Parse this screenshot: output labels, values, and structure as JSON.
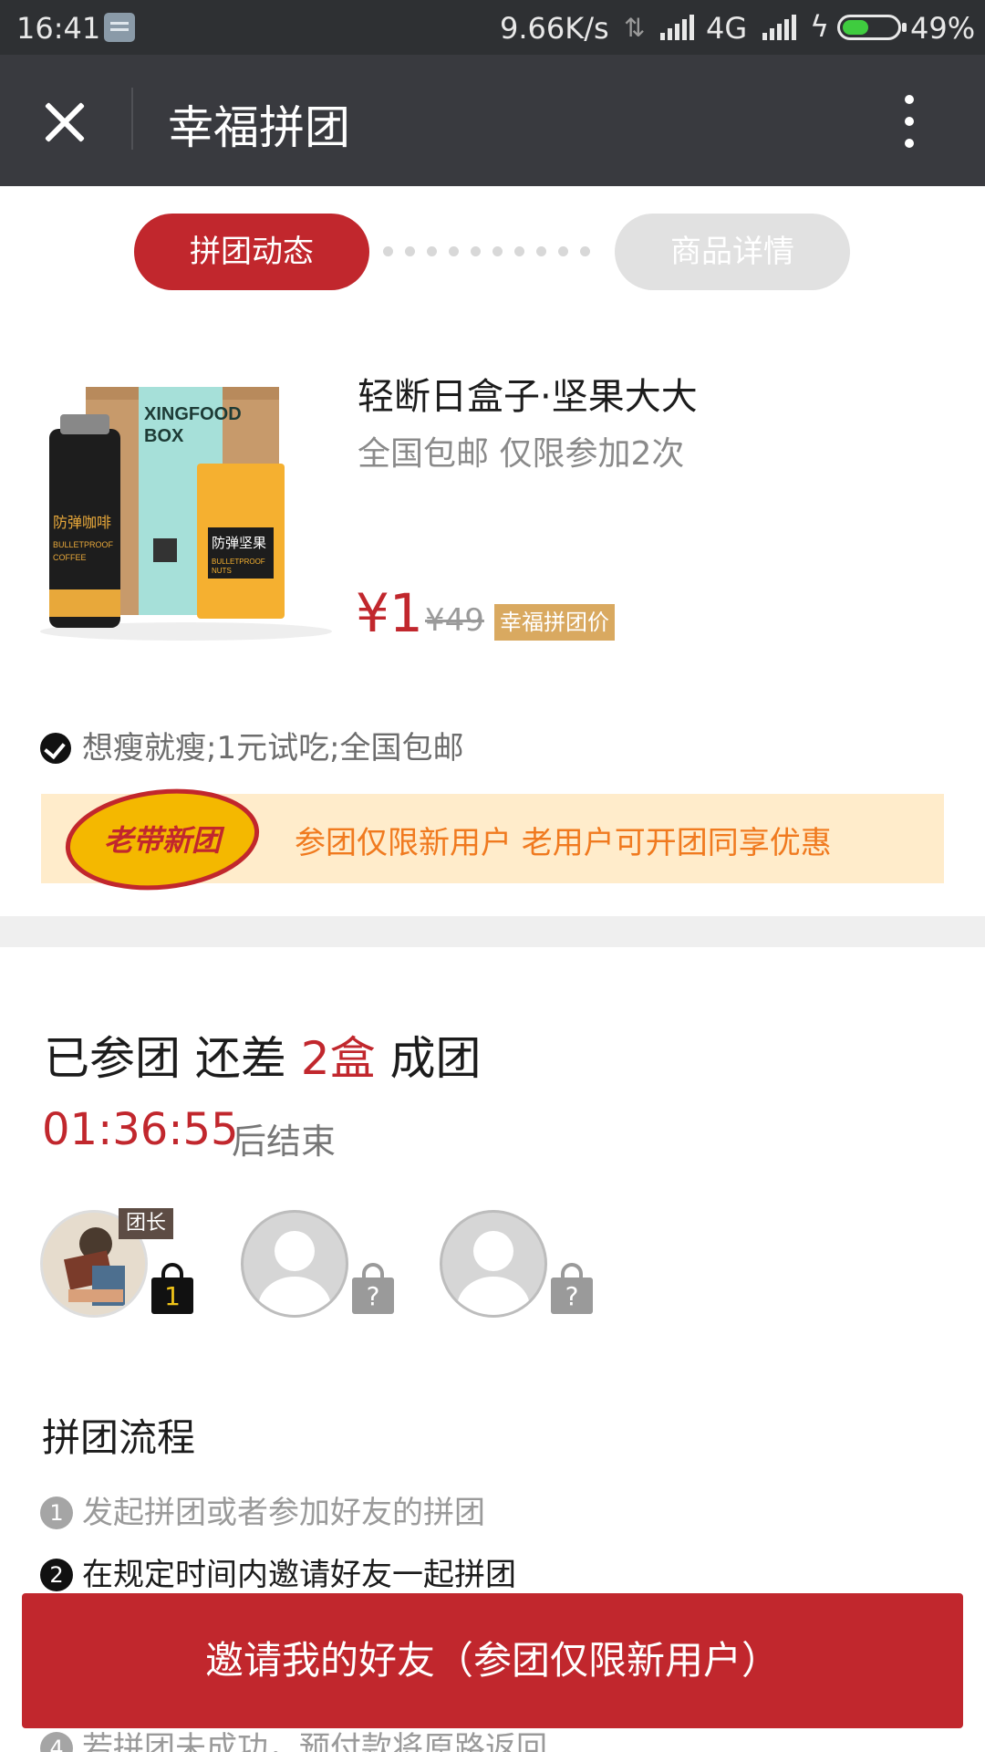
{
  "status_bar": {
    "time": "16:41",
    "speed": "9.66K/s",
    "network": "4G",
    "battery_percent": "49%",
    "battery_level": 0.49
  },
  "header": {
    "title": "幸福拼团"
  },
  "tabs": [
    {
      "label": "拼团动态",
      "active": true
    },
    {
      "label": "商品详情",
      "active": false
    }
  ],
  "product": {
    "name": "轻断日盒子·坚果大大",
    "desc": "全国包邮 仅限参加2次",
    "price": "¥1",
    "original_price": "¥49",
    "badge": "幸福拼团价",
    "image_texts": [
      "XINGFOOD",
      "BOX",
      "防弹咖啡",
      "BULLETPROOF",
      "COFFEE",
      "防弹坚果",
      "NUTS"
    ]
  },
  "feature": "想瘦就瘦;1元试吃;全国包邮",
  "promo": {
    "logo_text": "老带新团",
    "text": "参团仅限新用户 老用户可开团同享优惠"
  },
  "group": {
    "status_prefix": "已参团 还差 ",
    "status_highlight": "2盒",
    "status_suffix": " 成团",
    "timer": "01:36:55",
    "timer_suffix": "后结束",
    "leader_tag": "团长",
    "member_count": "1",
    "unknown_mark": "?"
  },
  "flow": {
    "title": "拼团流程",
    "steps": [
      {
        "num": "1",
        "text": "发起拼团或者参加好友的拼团"
      },
      {
        "num": "2",
        "text": "在规定时间内邀请好友一起拼团"
      },
      {
        "num": "4",
        "text": "若拼团未成功，预付款将原路返回"
      }
    ]
  },
  "invite_button": "邀请我的好友（参团仅限新用户）",
  "colors": {
    "brand_red": "#c1272d",
    "promo_bg": "#ffeccb",
    "promo_text": "#f07a1f",
    "header_bg": "#393a3f"
  }
}
